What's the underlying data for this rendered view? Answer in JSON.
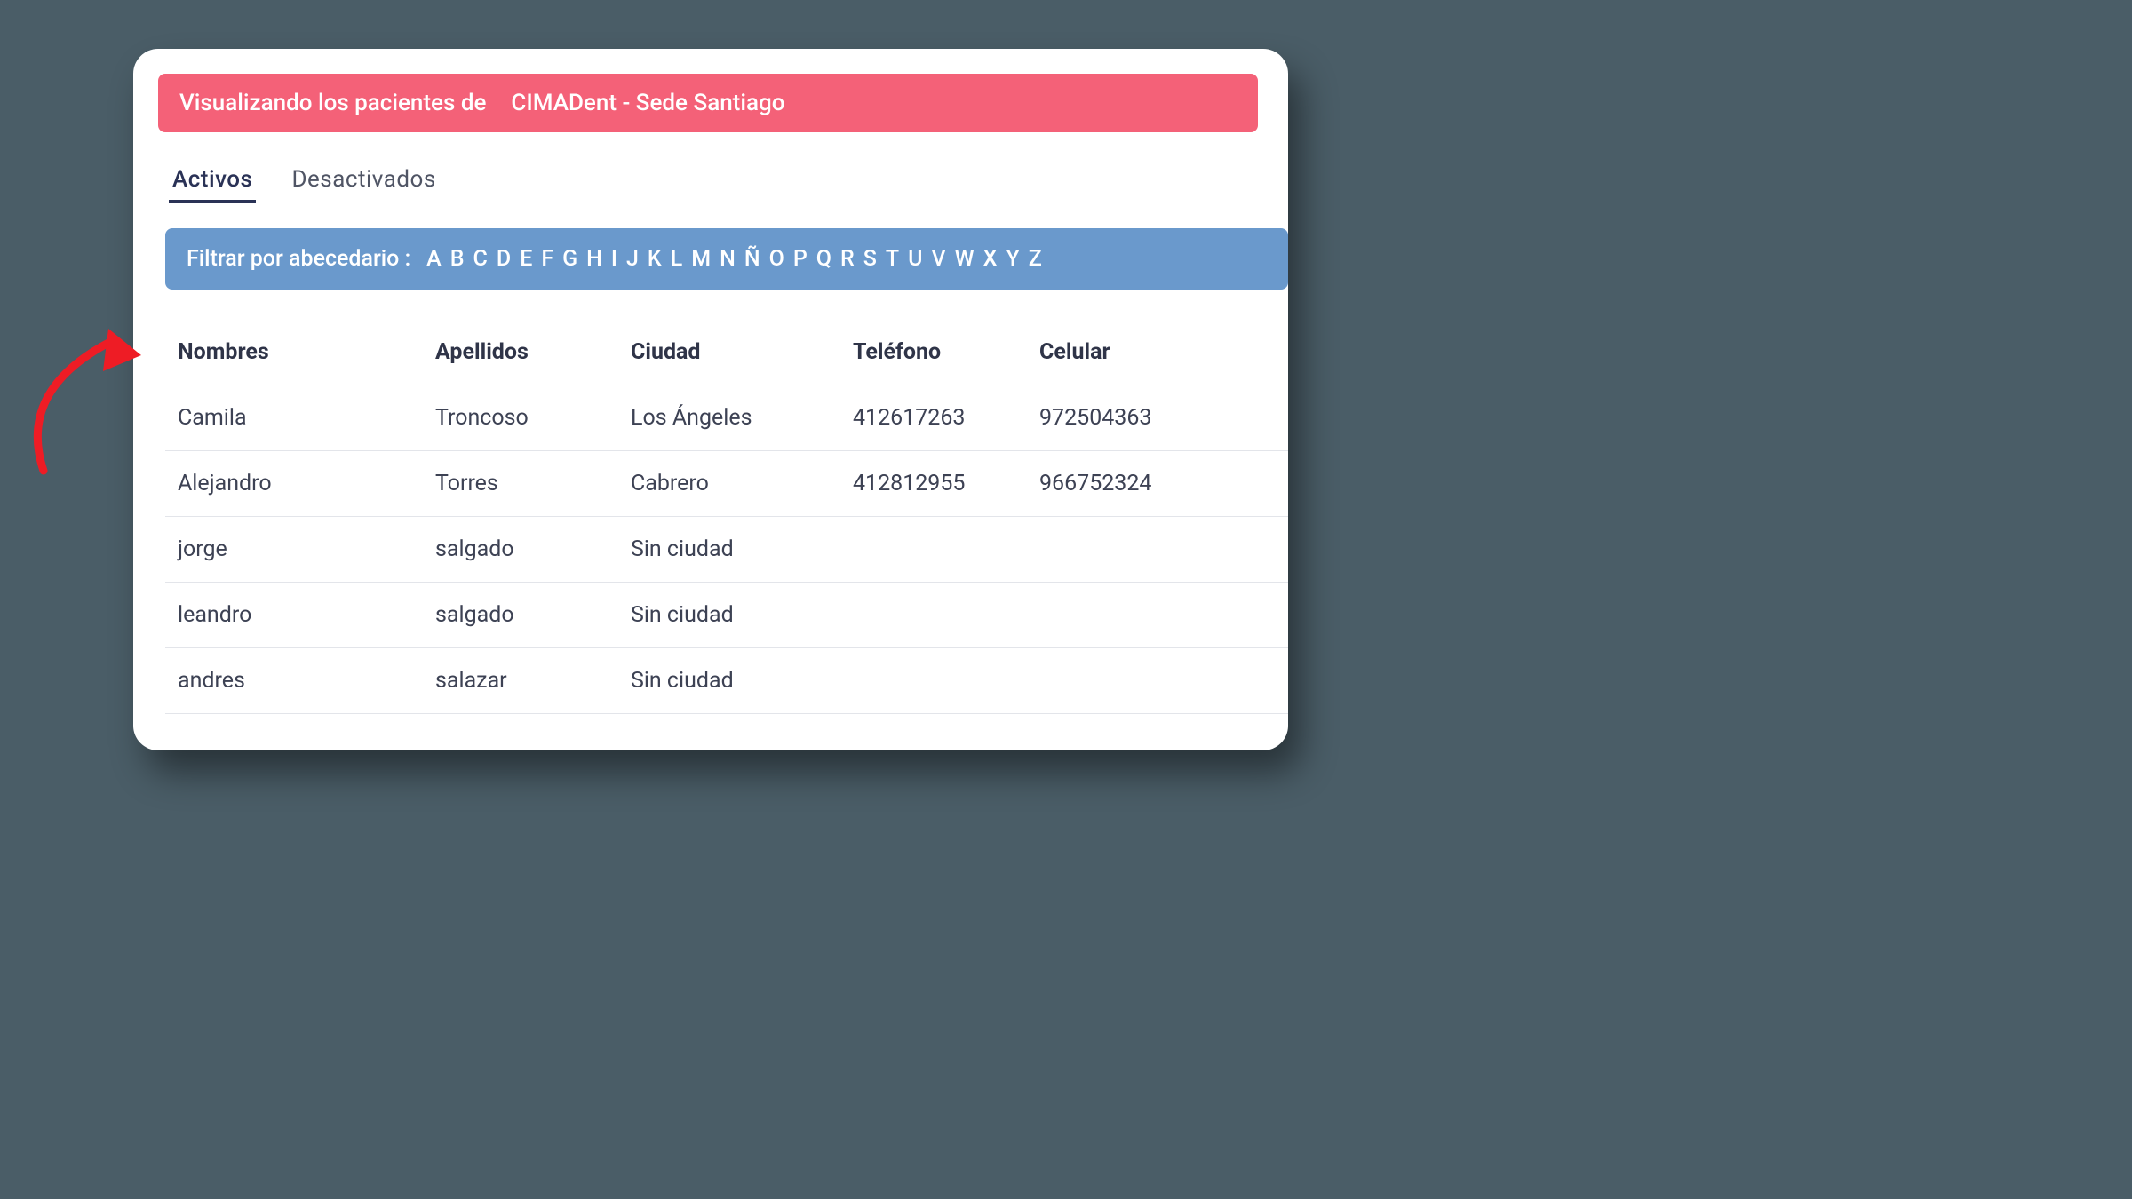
{
  "header": {
    "prefix": "Visualizando los pacientes de",
    "location": "CIMADent - Sede Santiago"
  },
  "tabs": {
    "active": "Activos",
    "inactive": "Desactivados"
  },
  "filter": {
    "label": "Filtrar por abecedario :",
    "letters": [
      "A",
      "B",
      "C",
      "D",
      "E",
      "F",
      "G",
      "H",
      "I",
      "J",
      "K",
      "L",
      "M",
      "N",
      "Ñ",
      "O",
      "P",
      "Q",
      "R",
      "S",
      "T",
      "U",
      "V",
      "W",
      "X",
      "Y",
      "Z"
    ]
  },
  "table": {
    "headers": {
      "nombres": "Nombres",
      "apellidos": "Apellidos",
      "ciudad": "Ciudad",
      "telefono": "Teléfono",
      "celular": "Celular"
    },
    "rows": [
      {
        "nombres": "Camila",
        "apellidos": "Troncoso",
        "ciudad": "Los Ángeles",
        "telefono": "412617263",
        "celular": "972504363"
      },
      {
        "nombres": "Alejandro",
        "apellidos": "Torres",
        "ciudad": "Cabrero",
        "telefono": "412812955",
        "celular": "966752324"
      },
      {
        "nombres": "jorge",
        "apellidos": "salgado",
        "ciudad": "Sin ciudad",
        "telefono": "",
        "celular": ""
      },
      {
        "nombres": "leandro",
        "apellidos": "salgado",
        "ciudad": "Sin ciudad",
        "telefono": "",
        "celular": ""
      },
      {
        "nombres": "andres",
        "apellidos": "salazar",
        "ciudad": "Sin ciudad",
        "telefono": "",
        "celular": ""
      }
    ]
  },
  "colors": {
    "banner": "#f46178",
    "filterBar": "#6a99cc",
    "tabActive": "#2a3256",
    "arrow": "#ee1c25"
  }
}
